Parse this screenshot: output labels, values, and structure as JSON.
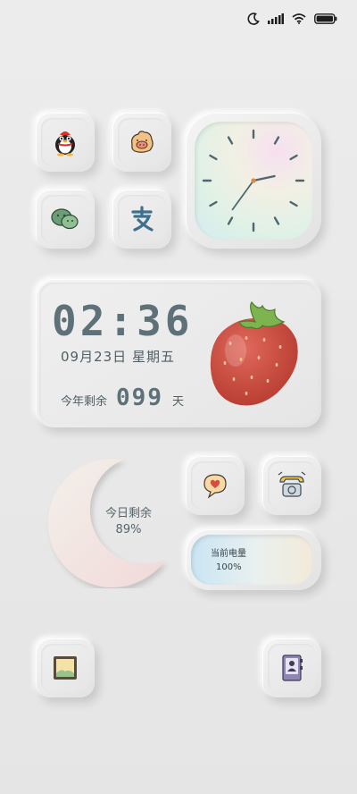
{
  "status_bar": {
    "icons": [
      "moon-icon",
      "signal-icon",
      "wifi-icon",
      "battery-icon"
    ]
  },
  "apps": [
    {
      "id": "qq",
      "icon": "penguin-icon"
    },
    {
      "id": "weibo",
      "icon": "pig-face-icon"
    },
    {
      "id": "wechat",
      "icon": "wechat-bubble-icon"
    },
    {
      "id": "alipay",
      "icon": "alipay-icon"
    },
    {
      "id": "chat",
      "icon": "heart-bubble-icon"
    },
    {
      "id": "phone",
      "icon": "telephone-icon"
    },
    {
      "id": "gallery",
      "icon": "picture-frame-icon"
    },
    {
      "id": "contacts",
      "icon": "contact-book-icon"
    }
  ],
  "clock": {
    "hour": 2,
    "minute": 36
  },
  "time_widget": {
    "time": "02:36",
    "date": "09月23日 星期五",
    "remaining_prefix": "今年剩余",
    "remaining_days": "099",
    "remaining_suffix": "天"
  },
  "moon_widget": {
    "label": "今日剩余",
    "value": "89%",
    "fraction": 0.89
  },
  "battery_widget": {
    "label": "当前电量",
    "value": "100%",
    "fraction": 1.0
  },
  "colors": {
    "background": "#e7e7e7",
    "text_primary": "#5e7179",
    "strawberry": "#c9483c",
    "leaf": "#6fa64a"
  }
}
